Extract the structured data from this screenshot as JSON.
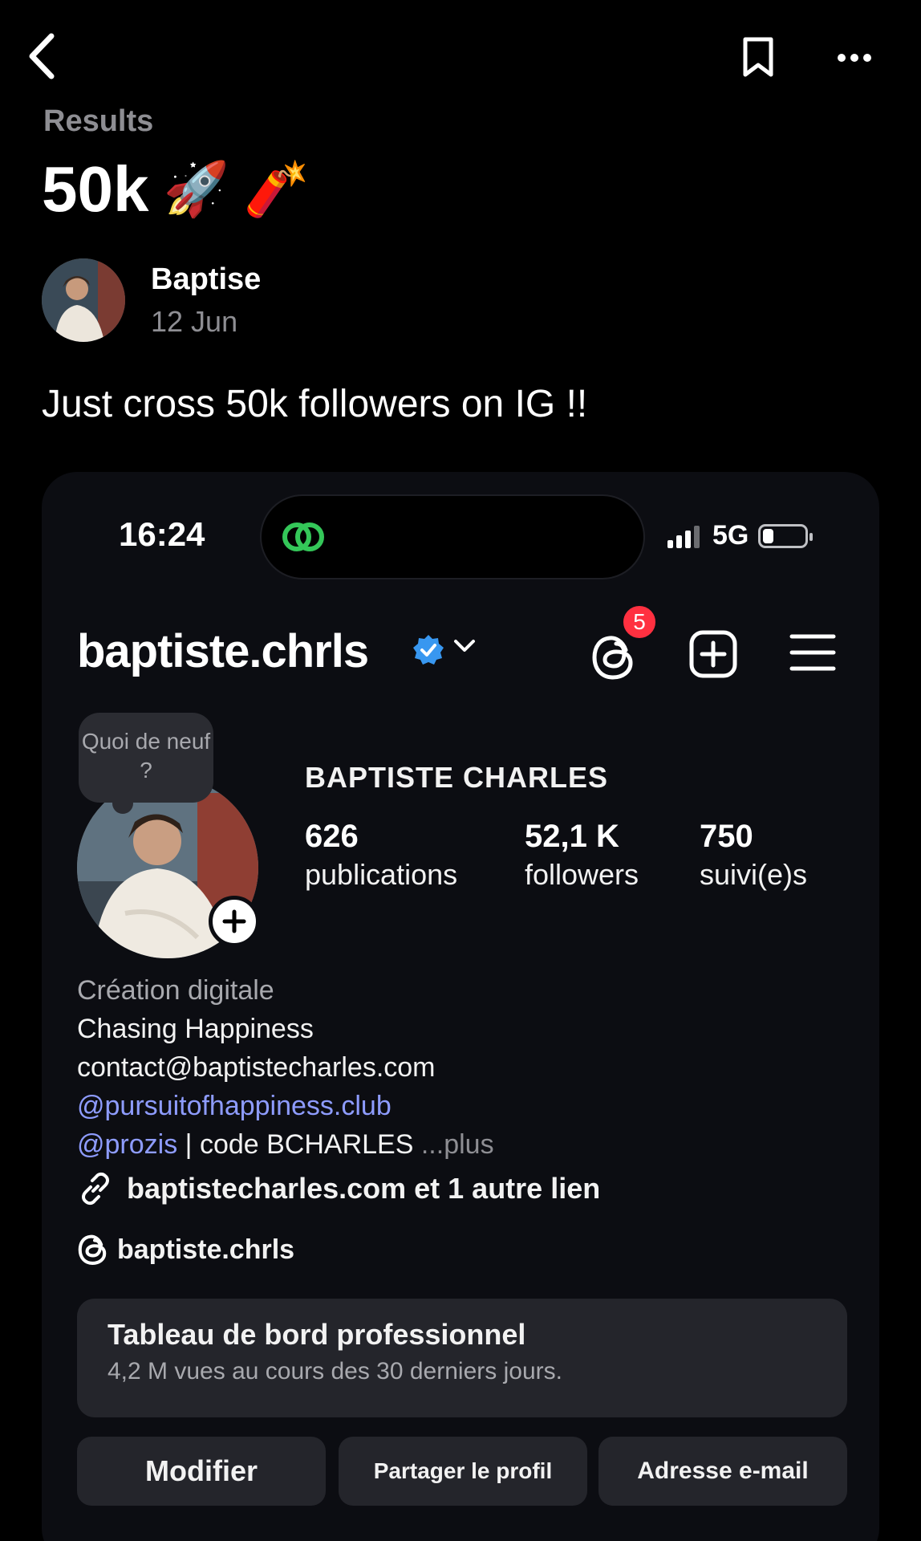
{
  "nav": {
    "back_icon": "chevron-left-icon",
    "bookmark_icon": "bookmark-icon",
    "more_icon": "more-horizontal-icon"
  },
  "post": {
    "section_label": "Results",
    "title": "50k",
    "title_emojis": [
      "🚀",
      "🧨"
    ],
    "author_name": "Baptise",
    "date": "12 Jun",
    "body": "Just cross 50k followers on IG !!"
  },
  "screenshot": {
    "status": {
      "time": "16:24",
      "network": "5G",
      "battery_level": 0.25
    },
    "profile": {
      "username": "baptiste.chrls",
      "notification_count": "5",
      "note": "Quoi de neuf ?",
      "full_name": "BAPTISTE CHARLES",
      "stats": [
        {
          "value": "626",
          "label": "publications"
        },
        {
          "value": "52,1 K",
          "label": "followers"
        },
        {
          "value": "750",
          "label": "suivi(e)s"
        }
      ],
      "bio": {
        "category": "Création digitale",
        "tagline": "Chasing Happiness",
        "email": "contact@baptistecharles.com",
        "mention_1": "@pursuitofhappiness.club",
        "mention_2": "@prozis",
        "code": " | code BCHARLES",
        "ellipsis": " ...",
        "more": "plus"
      },
      "links_text": "baptistecharles.com et 1 autre lien",
      "threads_handle": "baptiste.chrls",
      "dashboard": {
        "title": "Tableau de bord professionnel",
        "subtitle": "4,2 M vues au cours des 30 derniers jours."
      },
      "buttons": {
        "edit": "Modifier",
        "share": "Partager le profil",
        "email": "Adresse e-mail"
      }
    }
  },
  "colors": {
    "background": "#000000",
    "card": "#0c0d12",
    "muted": "#8e8e93",
    "link": "#8e9cff",
    "badge": "#ff3040",
    "verified": "#3897f0"
  }
}
